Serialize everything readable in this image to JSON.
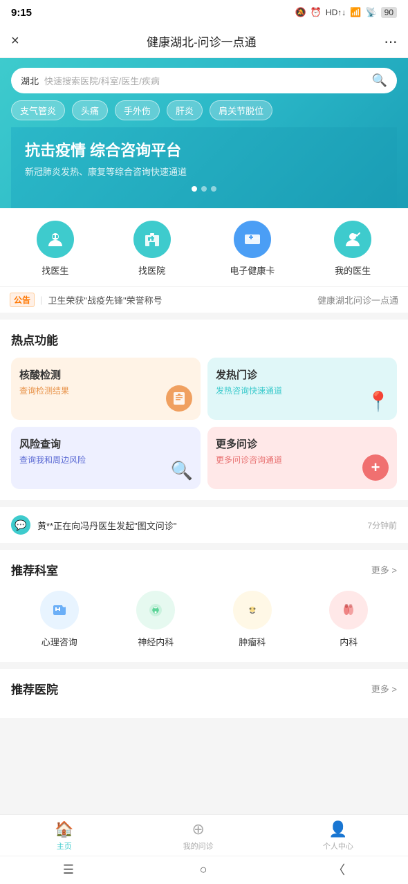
{
  "statusBar": {
    "time": "9:15",
    "icons": "🔕 ⏰ HD↑↓ 📶 WiFi 90"
  },
  "navBar": {
    "close": "×",
    "title": "健康湖北-问诊一点通",
    "more": "···"
  },
  "search": {
    "region": "湖北",
    "placeholder": "快速搜索医院/科室/医生/疾病"
  },
  "quickTags": [
    "支气管炎",
    "头痛",
    "手外伤",
    "肝炎",
    "肩关节脱位"
  ],
  "banner": {
    "title": "抗击疫情 综合咨询平台",
    "subtitle": "新冠肺炎发热、康复等综合咨询快速通道",
    "dots": 3,
    "activeDot": 0
  },
  "quickNav": [
    {
      "label": "找医生",
      "iconClass": "icon-doctor",
      "symbol": "👨‍⚕️"
    },
    {
      "label": "找医院",
      "iconClass": "icon-hospital",
      "symbol": "🏥"
    },
    {
      "label": "电子健康卡",
      "iconClass": "icon-card",
      "symbol": "💳"
    },
    {
      "label": "我的医生",
      "iconClass": "icon-myDoctor",
      "symbol": "❤️"
    }
  ],
  "notice": {
    "tag": "公告",
    "separator": "|",
    "text": "卫生荣获\"战疫先锋\"荣誉称号",
    "trailing": "健康湖北问诊一点通"
  },
  "hotFunctions": {
    "title": "热点功能",
    "cards": [
      {
        "id": "nucleic",
        "title": "核酸检测",
        "sub": "查询检测结果",
        "cardClass": "card-nucleic",
        "iconSymbol": "📋"
      },
      {
        "id": "fever",
        "title": "发热门诊",
        "sub": "发热咨询快速通道",
        "cardClass": "card-fever",
        "iconSymbol": "📍"
      },
      {
        "id": "risk",
        "title": "风险查询",
        "sub": "查询我和周边风险",
        "cardClass": "card-risk",
        "iconSymbol": "🔍"
      },
      {
        "id": "more",
        "title": "更多问诊",
        "sub": "更多问诊咨询通道",
        "cardClass": "card-more",
        "iconSymbol": "+"
      }
    ]
  },
  "liveFeed": {
    "text": "黄**正在向冯丹医生发起\"图文问诊\"",
    "time": "7分钟前"
  },
  "recommendedDepts": {
    "title": "推荐科室",
    "more": "更多 >",
    "items": [
      {
        "label": "心理咨询",
        "iconClass": "dept-psych",
        "symbol": "🏥"
      },
      {
        "label": "神经内科",
        "iconClass": "dept-neuro",
        "symbol": "❄️"
      },
      {
        "label": "肿瘤科",
        "iconClass": "dept-tumor",
        "symbol": "😊"
      },
      {
        "label": "内科",
        "iconClass": "dept-internal",
        "symbol": "🫁"
      }
    ]
  },
  "recommendedHospitals": {
    "title": "推荐医院",
    "more": "更多 >"
  },
  "bottomNav": {
    "tabs": [
      {
        "label": "主页",
        "active": true,
        "symbol": "🏠"
      },
      {
        "label": "我的问诊",
        "active": false,
        "symbol": "⊕"
      },
      {
        "label": "个人中心",
        "active": false,
        "symbol": "👤"
      }
    ],
    "systemBtns": [
      "☰",
      "○",
      "〈"
    ]
  }
}
